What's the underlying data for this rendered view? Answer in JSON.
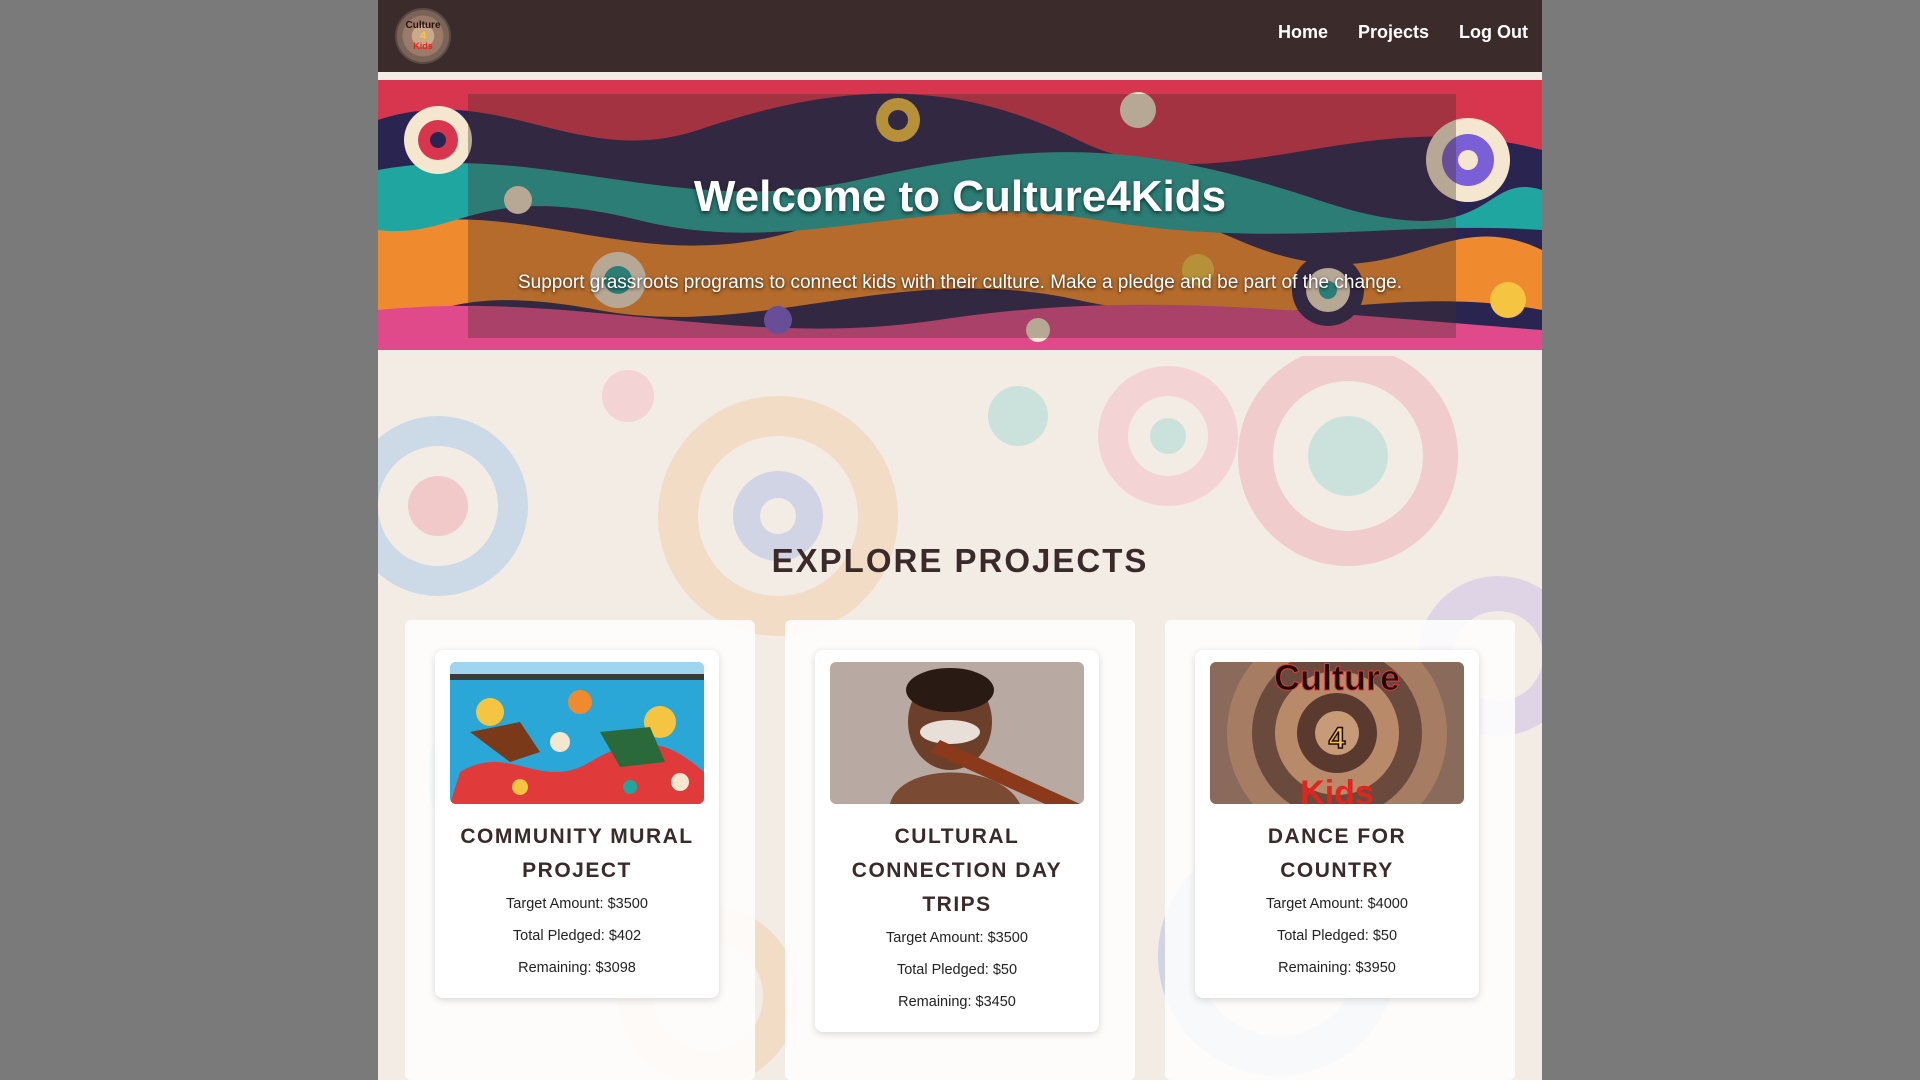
{
  "logo": {
    "line1": "Culture",
    "line2": "4",
    "line3": "Kids"
  },
  "nav": {
    "home": "Home",
    "projects": "Projects",
    "logout": "Log Out"
  },
  "hero": {
    "title": "Welcome to Culture4Kids",
    "subtitle": "Support grassroots programs to connect kids with their culture. Make a pledge and be part of the change."
  },
  "projects_section": {
    "title": "EXPLORE PROJECTS"
  },
  "projects": [
    {
      "title": "COMMUNITY MURAL PROJECT",
      "target": "Target Amount: $3500",
      "pledged": "Total Pledged: $402",
      "remaining": "Remaining: $3098"
    },
    {
      "title": "CULTURAL CONNECTION DAY TRIPS",
      "target": "Target Amount: $3500",
      "pledged": "Total Pledged: $50",
      "remaining": "Remaining: $3450"
    },
    {
      "title": "DANCE FOR COUNTRY",
      "target": "Target Amount: $4000",
      "pledged": "Total Pledged: $50",
      "remaining": "Remaining: $3950"
    }
  ],
  "project3_image_text": {
    "top": "Culture",
    "middle": "4",
    "bottom": "Kids"
  },
  "colors": {
    "navbar": "#3b2b2b",
    "heading": "#3a2a2a",
    "page_background": "#7a7a7a"
  }
}
